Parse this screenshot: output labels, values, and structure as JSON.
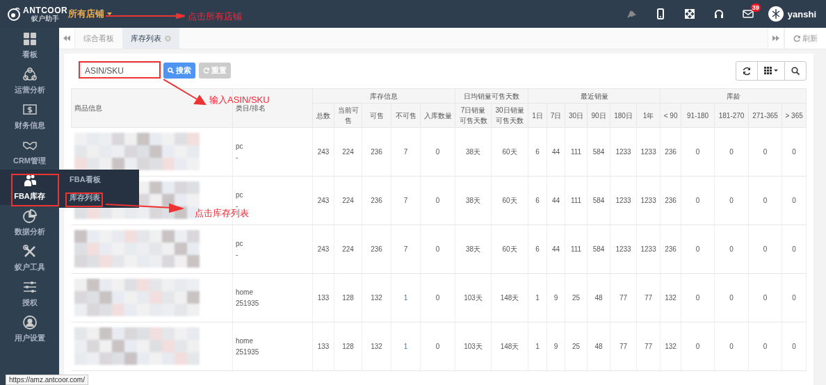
{
  "topbar": {
    "logo": "ANTCOOR",
    "logo_sub": "蚁户助手",
    "store_menu": "所有店铺",
    "mail_badge": "39",
    "user": "yanshi"
  },
  "sidebar": {
    "items": [
      {
        "label": "看板",
        "kind": "grid",
        "selected": false
      },
      {
        "label": "运营分析",
        "kind": "network",
        "selected": false
      },
      {
        "label": "财务信息",
        "kind": "dollar",
        "selected": false
      },
      {
        "label": "CRM管理",
        "kind": "handshake",
        "selected": false
      },
      {
        "label": "FBA库存",
        "kind": "users",
        "selected": true
      },
      {
        "label": "数据分析",
        "kind": "pie",
        "selected": false
      },
      {
        "label": "蚁户工具",
        "kind": "tools",
        "selected": false
      },
      {
        "label": "授权",
        "kind": "sliders",
        "selected": false
      },
      {
        "label": "用户设置",
        "kind": "user",
        "selected": false
      }
    ],
    "flyout": [
      {
        "label": "FBA看板"
      },
      {
        "label": "库存列表"
      }
    ]
  },
  "tabs": {
    "items": [
      {
        "label": "综合看板",
        "selected": false,
        "closable": false
      },
      {
        "label": "库存列表",
        "selected": true,
        "closable": true
      }
    ],
    "refresh": "刷新"
  },
  "search": {
    "placeholder": "ASIN/SKU",
    "search_button": "搜索",
    "reset_button": "重置",
    "reset_disabled": true
  },
  "table": {
    "columns": [
      "商品信息",
      "类目/排名"
    ],
    "groups": [
      {
        "label": "库存信息",
        "columns": [
          "总数",
          "当前可售",
          "可售",
          "不可售",
          "入库数量"
        ]
      },
      {
        "label": "日均销量可售天数",
        "columns": [
          "7日销量可售天数",
          "30日销量可售天数"
        ]
      },
      {
        "label": "最近销量",
        "columns": [
          "1日",
          "7日",
          "30日",
          "90日",
          "180日",
          "1年"
        ]
      },
      {
        "label": "库龄",
        "columns": [
          "< 90",
          "91-180",
          "181-270",
          "271-365",
          "> 365"
        ]
      }
    ],
    "rows": [
      {
        "category": "pc",
        "rank": "-",
        "unsellable_link": false,
        "values": [
          "243",
          "224",
          "236",
          "7",
          "0",
          "38天",
          "60天",
          "6",
          "44",
          "111",
          "584",
          "1233",
          "1233",
          "236",
          "0",
          "0",
          "0",
          "0"
        ]
      },
      {
        "category": "pc",
        "rank": "-",
        "unsellable_link": false,
        "values": [
          "243",
          "224",
          "236",
          "7",
          "0",
          "38天",
          "60天",
          "6",
          "44",
          "111",
          "584",
          "1233",
          "1233",
          "236",
          "0",
          "0",
          "0",
          "0"
        ]
      },
      {
        "category": "pc",
        "rank": "-",
        "unsellable_link": false,
        "values": [
          "243",
          "224",
          "236",
          "7",
          "0",
          "38天",
          "60天",
          "6",
          "44",
          "111",
          "584",
          "1233",
          "1233",
          "236",
          "0",
          "0",
          "0",
          "0"
        ]
      },
      {
        "category": "home",
        "rank": "251935",
        "unsellable_link": true,
        "values": [
          "133",
          "128",
          "132",
          "1",
          "0",
          "103天",
          "148天",
          "1",
          "9",
          "25",
          "48",
          "77",
          "77",
          "132",
          "0",
          "0",
          "0",
          "0"
        ]
      },
      {
        "category": "home",
        "rank": "251935",
        "unsellable_link": true,
        "values": [
          "133",
          "128",
          "132",
          "1",
          "0",
          "103天",
          "148天",
          "1",
          "9",
          "25",
          "48",
          "77",
          "77",
          "132",
          "0",
          "0",
          "0",
          "0"
        ]
      }
    ]
  },
  "annotations": [
    {
      "text": "点击所有店铺"
    },
    {
      "text": "输入ASIN/SKU"
    },
    {
      "text": "点击库存列表"
    }
  ],
  "status_url": "https://amz.antcoor.com/"
}
